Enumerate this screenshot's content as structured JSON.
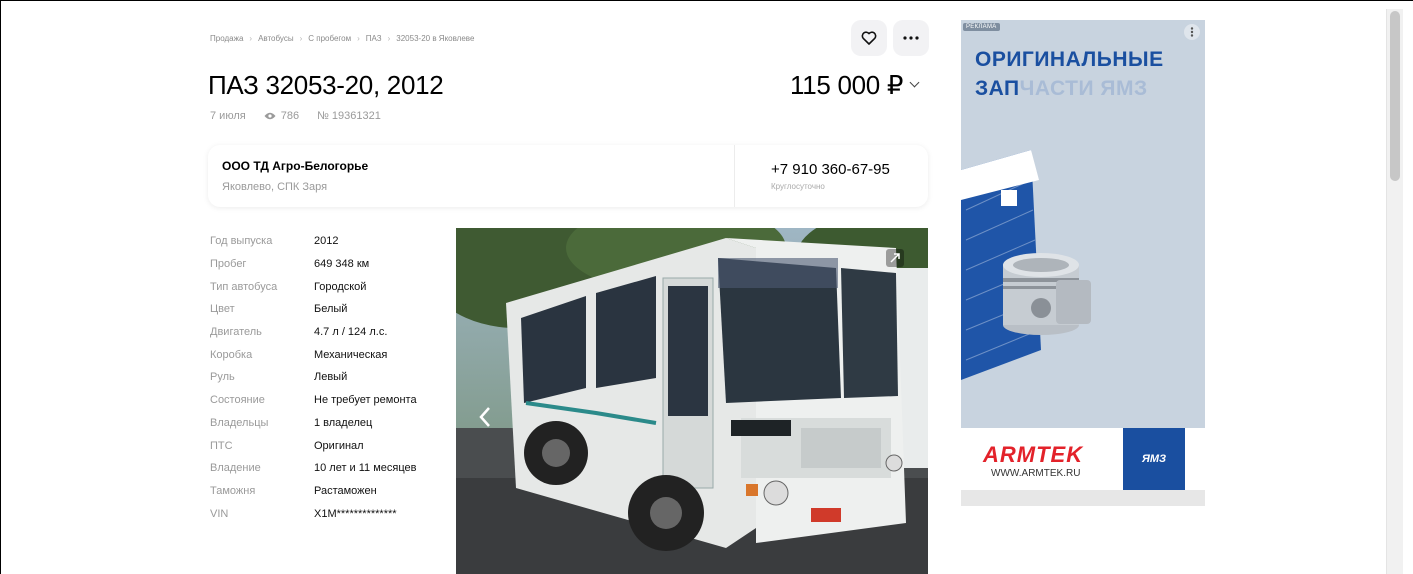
{
  "breadcrumb": [
    "Продажа",
    "Автобусы",
    "С пробегом",
    "ПАЗ",
    "32053-20 в Яковлеве"
  ],
  "listing": {
    "title": "ПАЗ 32053-20, 2012",
    "price": "115 000 ₽",
    "date": "7 июля",
    "views": "786",
    "number": "№ 19361321"
  },
  "seller": {
    "name": "ООО ТД Агро-Белогорье",
    "location": "Яковлево, СПК Заря",
    "phone": "+7 910 360-67-95",
    "phone_note": "Круглосуточно"
  },
  "specs": [
    {
      "label": "Год выпуска",
      "value": "2012"
    },
    {
      "label": "Пробег",
      "value": "649 348 км"
    },
    {
      "label": "Тип автобуса",
      "value": "Городской"
    },
    {
      "label": "Цвет",
      "value": "Белый"
    },
    {
      "label": "Двигатель",
      "value": "4.7 л / 124 л.с."
    },
    {
      "label": "Коробка",
      "value": "Механическая"
    },
    {
      "label": "Руль",
      "value": "Левый"
    },
    {
      "label": "Состояние",
      "value": "Не требует ремонта"
    },
    {
      "label": "Владельцы",
      "value": "1 владелец"
    },
    {
      "label": "ПТС",
      "value": "Оригинал"
    },
    {
      "label": "Владение",
      "value": "10 лет и 11 месяцев"
    },
    {
      "label": "Таможня",
      "value": "Растаможен"
    },
    {
      "label": "VIN",
      "value": "X1M**************"
    }
  ],
  "ad": {
    "tag": "РЕКЛАМА",
    "headline1": "ОРИГИНАЛЬНЫЕ",
    "headline2a": "ЗАП",
    "headline2b": "ЧАСТИ ЯМЗ",
    "brand": "ARMTEK",
    "url": "WWW.ARMTEK.RU",
    "partner": "ЯМЗ"
  },
  "colors": {
    "accent": "#1a4fa0",
    "armtek_red": "#e3222a"
  },
  "icons": [
    "heart-icon",
    "more-icon",
    "eye-icon",
    "chevron-down-icon",
    "expand-icon",
    "chevron-left-icon"
  ]
}
